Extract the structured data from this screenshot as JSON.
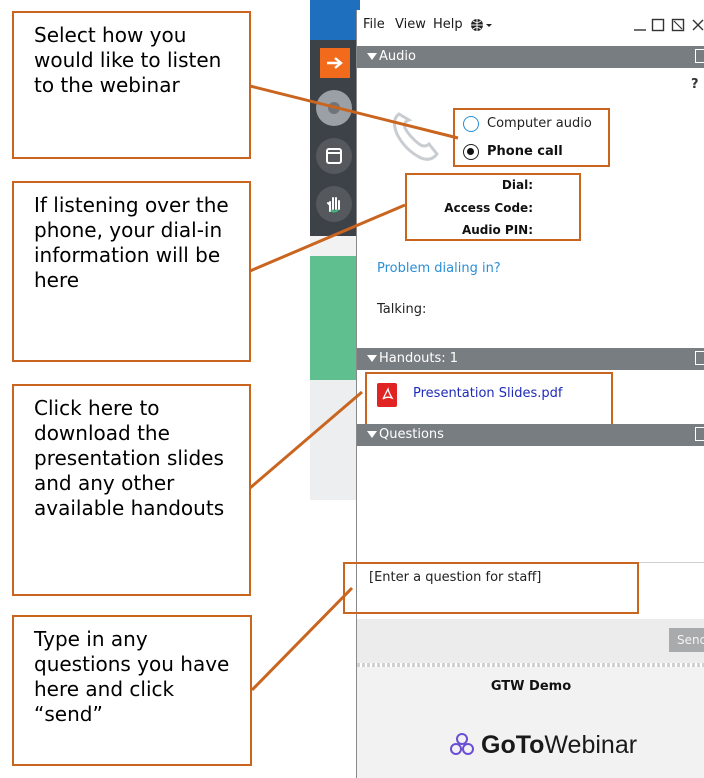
{
  "callouts": {
    "audio": "Select how you would like to listen to the webinar",
    "dialin": "If listening over the phone, your dial-in information will be here",
    "handouts": "Click here to download the presentation slides and any other available handouts",
    "questions": "Type in any questions you have here and click “send”"
  },
  "menu": {
    "file": "File",
    "view": "View",
    "help": "Help"
  },
  "audio": {
    "header": "Audio",
    "help_mark": "?",
    "option_computer": "Computer audio",
    "option_phone": "Phone call",
    "selected": "Phone call",
    "dial_label": "Dial:",
    "access_code_label": "Access Code:",
    "audio_pin_label": "Audio PIN:",
    "problem_link": "Problem dialing in?",
    "talking_label": "Talking:"
  },
  "handouts": {
    "header": "Handouts: 1",
    "file_name": "Presentation Slides.pdf"
  },
  "questions": {
    "header": "Questions",
    "placeholder": "[Enter a question for staff]",
    "send_label": "Send"
  },
  "footer": {
    "webinar_title": "GTW Demo",
    "brand_bold": "GoTo",
    "brand_light": "Webinar"
  },
  "colors": {
    "callout_border": "#c9651e",
    "header_bg": "#787d82",
    "link": "#2a8fd6",
    "pdf_red": "#e02424",
    "rail_orange": "#f26b1d"
  },
  "icons": [
    "arrow-right-icon",
    "phone-handset-icon",
    "window-icon",
    "raise-hand-icon",
    "globe-icon",
    "pdf-file-icon",
    "gotowebinar-logo-icon",
    "phone-watermark-icon"
  ]
}
